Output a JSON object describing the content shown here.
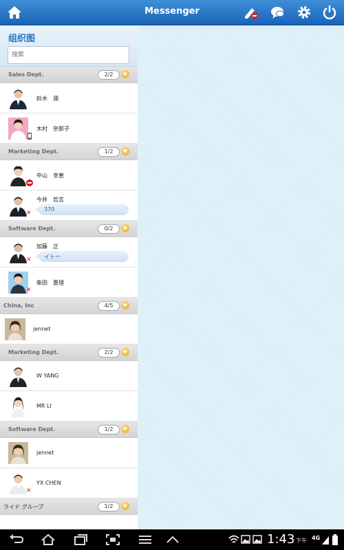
{
  "header": {
    "title": "Messenger"
  },
  "sidebar": {
    "title": "组织图",
    "search_placeholder": "搜索",
    "groups": [
      {
        "name": "Sales Dept.",
        "count": "2/2",
        "members": [
          {
            "name": "鈴木　潤"
          },
          {
            "name": "木村　奈那子"
          }
        ]
      },
      {
        "name": "Marketing Dept.",
        "count": "1/2",
        "members": [
          {
            "name": "中山　幸恵"
          },
          {
            "name": "今井　哲志",
            "message": "370"
          }
        ]
      },
      {
        "name": "Software Dept.",
        "count": "0/2",
        "members": [
          {
            "name": "加藤　正",
            "message": "イトー"
          },
          {
            "name": "柴田　惠理"
          }
        ]
      },
      {
        "name": "China, Inc",
        "count": "4/5",
        "members": [
          {
            "name": "jennet"
          }
        ]
      },
      {
        "name": "Marketing Dept.",
        "count": "2/2",
        "members": [
          {
            "name": "W YANG"
          },
          {
            "name": "MR LI"
          }
        ]
      },
      {
        "name": "Software Dept.",
        "count": "1/2",
        "members": [
          {
            "name": "jennet"
          },
          {
            "name": "YX CHEN"
          }
        ]
      },
      {
        "name": "ライド グループ",
        "count": "1/2",
        "members": []
      }
    ]
  },
  "system_bar": {
    "time": "1:43",
    "ampm": "下午",
    "network": "4G"
  },
  "colors": {
    "header": "#2574c8",
    "accent": "#2a73c4",
    "right_bg": "#d9eef7"
  }
}
